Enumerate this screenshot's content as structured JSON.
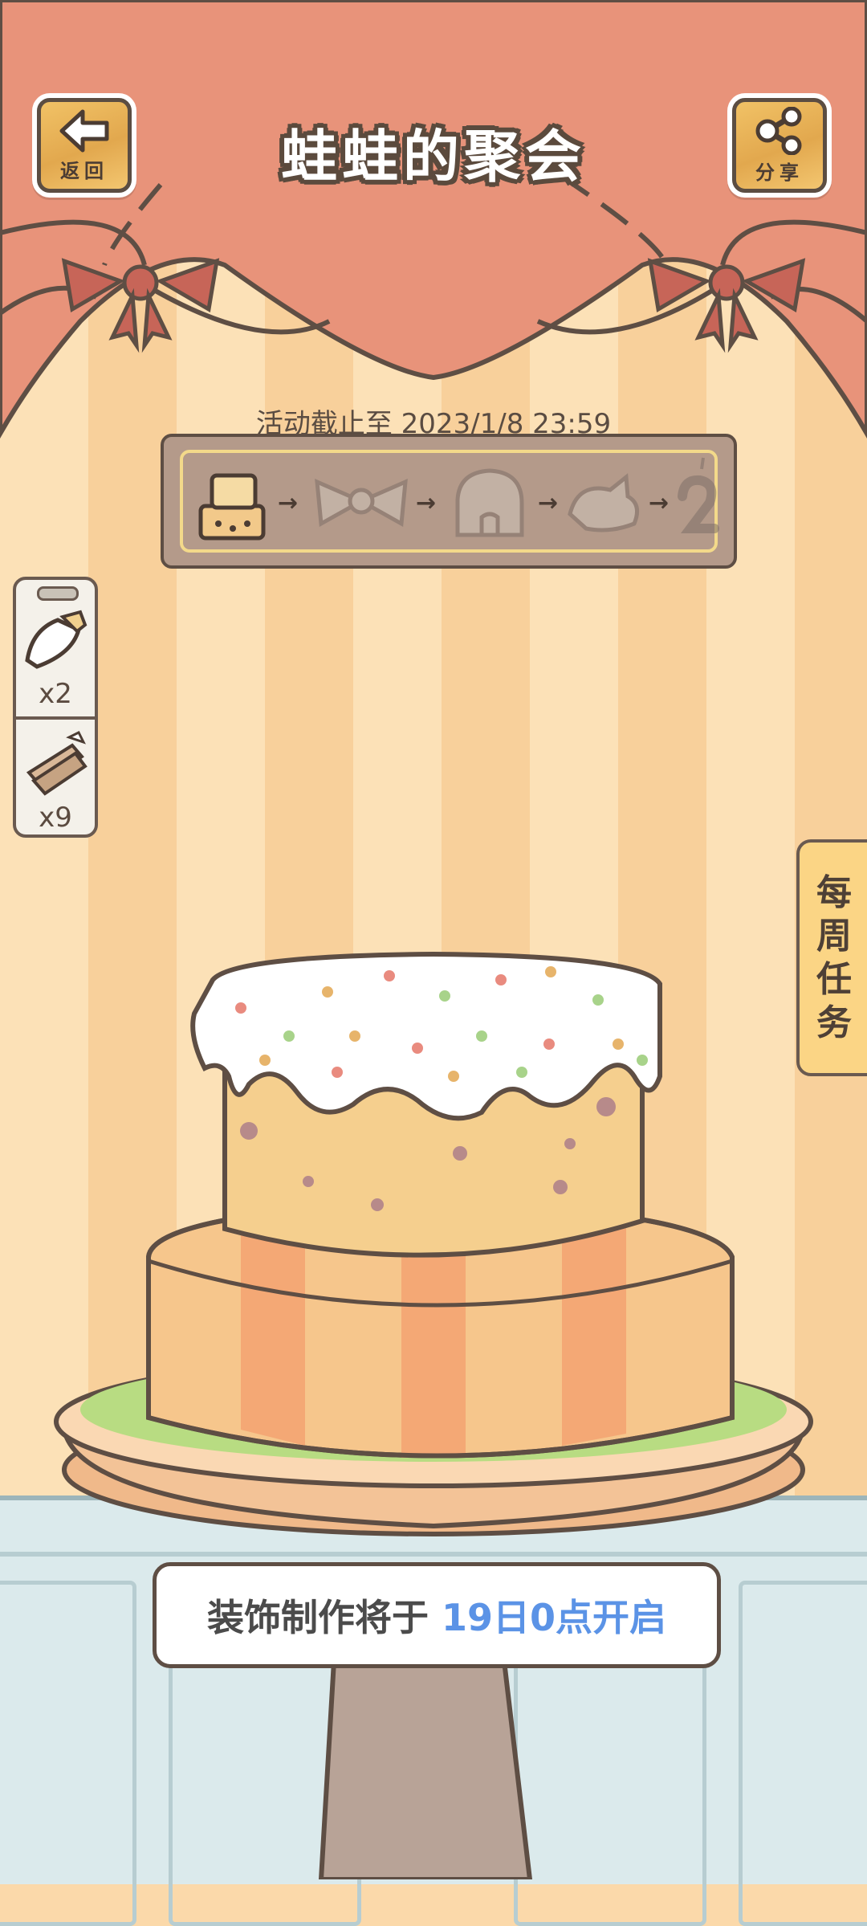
{
  "header": {
    "title": "蛙蛙的聚会",
    "back_label": "返回",
    "share_label": "分享"
  },
  "event": {
    "deadline": "活动截止至 2023/1/8 23:59",
    "progress_steps": [
      {
        "icon": "cake-icon",
        "active": true
      },
      {
        "icon": "bow-icon",
        "active": false
      },
      {
        "icon": "cream-icon",
        "active": false
      },
      {
        "icon": "creature-icon",
        "active": false
      },
      {
        "icon": "number-candle-icon",
        "active": false
      }
    ]
  },
  "inventory": {
    "items": [
      {
        "icon": "piping-bag-icon",
        "count": "x2"
      },
      {
        "icon": "piping-bag-bundle-icon",
        "count": "x9"
      }
    ]
  },
  "weekly_tasks": {
    "chars": [
      "每",
      "周",
      "任",
      "务"
    ]
  },
  "notice": {
    "prefix": "装饰制作将于 ",
    "highlight": "19日0点开启",
    "highlight_color": "#5b93e6"
  },
  "colors": {
    "curtain": "#e8937a",
    "bow": "#c76558",
    "wall_stripe_light": "#fce1b7",
    "wall_stripe_dark": "#f8d09b",
    "outline": "#5e4e44"
  }
}
